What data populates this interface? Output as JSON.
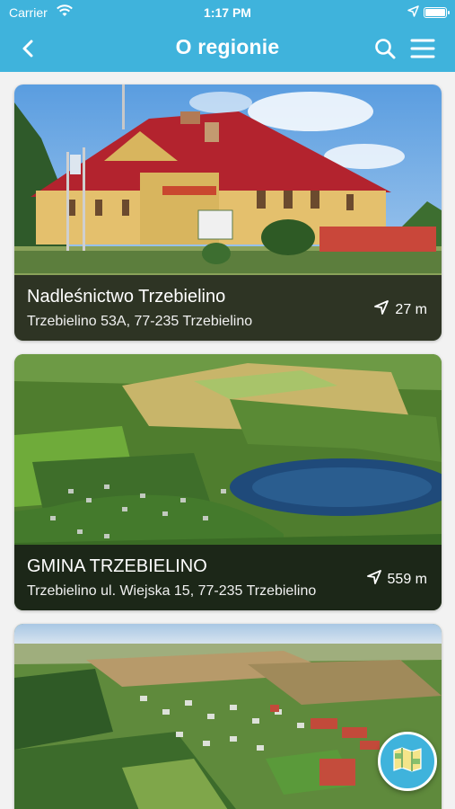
{
  "status_bar": {
    "carrier": "Carrier",
    "time": "1:17 PM"
  },
  "nav": {
    "title": "O regionie",
    "icons": [
      "back-arrow-icon",
      "search-icon",
      "hamburger-menu-icon"
    ]
  },
  "places": [
    {
      "name": "Nadleśnictwo Trzebielino",
      "address": "Trzebielino 53A, 77-235 Trzebielino",
      "distance": "27 m"
    },
    {
      "name": "GMINA TRZEBIELINO",
      "address": "Trzebielino ul. Wiejska 15, 77-235 Trzebielino",
      "distance": "559 m"
    }
  ],
  "fab": {
    "icon": "map-icon"
  },
  "colors": {
    "accent": "#3fb3dc"
  }
}
